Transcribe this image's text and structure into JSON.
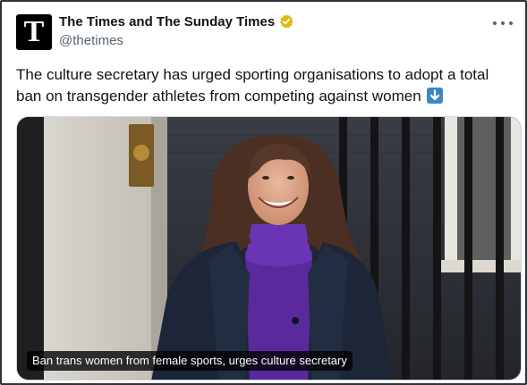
{
  "post": {
    "avatar_letter": "T",
    "display_name": "The Times and The Sunday Times",
    "handle": "@thetimes",
    "verified_badge_color": "#e2b719",
    "text": "The culture secretary has urged sporting organisations to adopt a total ban on transgender athletes from competing against women",
    "text_emoji": "down-arrow-emoji",
    "more_icon": "ellipsis-icon"
  },
  "media": {
    "caption": "Ban trans women from female sports, urges culture secretary"
  },
  "colors": {
    "text": "#0f1419",
    "secondary": "#536471",
    "border": "#2f3336",
    "emoji_blue": "#3b88c3"
  }
}
